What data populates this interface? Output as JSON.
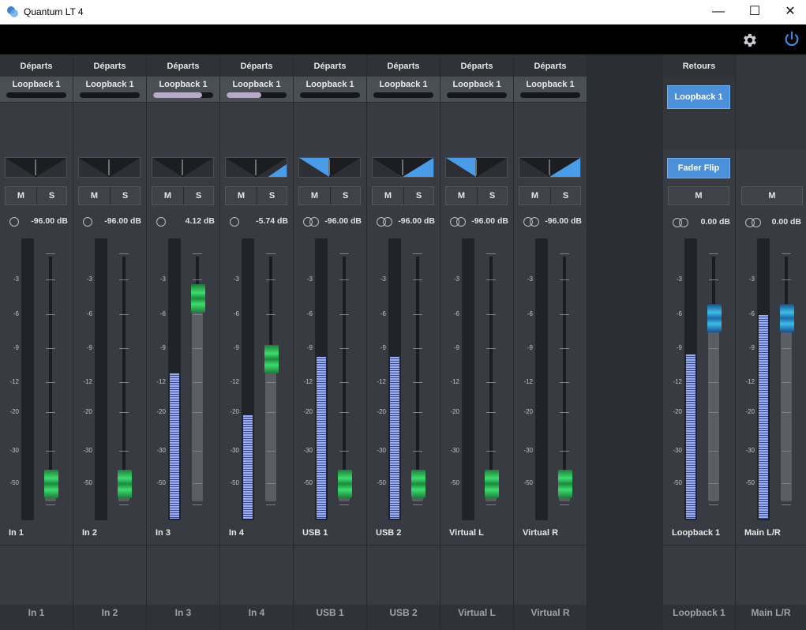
{
  "window": {
    "title": "Quantum LT 4",
    "minimize": "—",
    "maximize": "☐",
    "close": "✕"
  },
  "toolbar": {
    "settings_icon": "gear-icon",
    "power_icon": "power-icon"
  },
  "sends_header": "Départs",
  "returns_header": "Retours",
  "channels": [
    {
      "send_target": "Loopback  1",
      "send_level": 0,
      "pan": 0,
      "pan_dir": "center",
      "db": "-96.00 dB",
      "stereo": false,
      "meter": 0,
      "fader": 0.07,
      "color": "green",
      "name": "In  1",
      "bottom": "In  1"
    },
    {
      "send_target": "Loopback  1",
      "send_level": 0,
      "pan": 0,
      "pan_dir": "center",
      "db": "-96.00 dB",
      "stereo": false,
      "meter": 0,
      "fader": 0.07,
      "color": "green",
      "name": "In  2",
      "bottom": "In  2"
    },
    {
      "send_target": "Loopback  1",
      "send_level": 0.82,
      "pan": 0,
      "pan_dir": "center",
      "db": "4.12 dB",
      "stereo": false,
      "meter": 0.52,
      "fader": 0.83,
      "color": "green",
      "name": "In  3",
      "bottom": "In  3"
    },
    {
      "send_target": "Loopback  1",
      "send_level": 0.58,
      "pan": 0.6,
      "pan_dir": "right",
      "db": "-5.74 dB",
      "stereo": false,
      "meter": 0.37,
      "fader": 0.58,
      "color": "green",
      "name": "In  4",
      "bottom": "In  4"
    },
    {
      "send_target": "Loopback  1",
      "send_level": 0,
      "pan": 1,
      "pan_dir": "left",
      "db": "-96.00 dB",
      "stereo": true,
      "meter": 0.58,
      "fader": 0.07,
      "color": "green",
      "name": "USB  1",
      "bottom": "USB  1"
    },
    {
      "send_target": "Loopback  1",
      "send_level": 0,
      "pan": 1,
      "pan_dir": "right",
      "db": "-96.00 dB",
      "stereo": true,
      "meter": 0.58,
      "fader": 0.07,
      "color": "green",
      "name": "USB  2",
      "bottom": "USB  2"
    },
    {
      "send_target": "Loopback  1",
      "send_level": 0,
      "pan": 1,
      "pan_dir": "left",
      "db": "-96.00 dB",
      "stereo": true,
      "meter": 0,
      "fader": 0.07,
      "color": "green",
      "name": "Virtual L",
      "bottom": "Virtual L"
    },
    {
      "send_target": "Loopback  1",
      "send_level": 0,
      "pan": 1,
      "pan_dir": "right",
      "db": "-96.00 dB",
      "stereo": true,
      "meter": 0,
      "fader": 0.07,
      "color": "green",
      "name": "Virtual R",
      "bottom": "Virtual R"
    }
  ],
  "scale_labels": [
    "-3",
    "-6",
    "-9",
    "-12",
    "-20",
    "-30",
    "-50"
  ],
  "buttons": {
    "mute": "M",
    "solo": "S"
  },
  "returns": {
    "target": "Loopback  1",
    "fader_flip": "Fader Flip",
    "mute": "M",
    "db": "0.00 dB",
    "meter": 0.59,
    "fader": 0.75,
    "name": "Loopback  1",
    "bottom": "Loopback  1"
  },
  "main": {
    "mute": "M",
    "db": "0.00 dB",
    "meter": 0.73,
    "fader": 0.75,
    "name": "Main L/R",
    "bottom": "Main L/R"
  }
}
